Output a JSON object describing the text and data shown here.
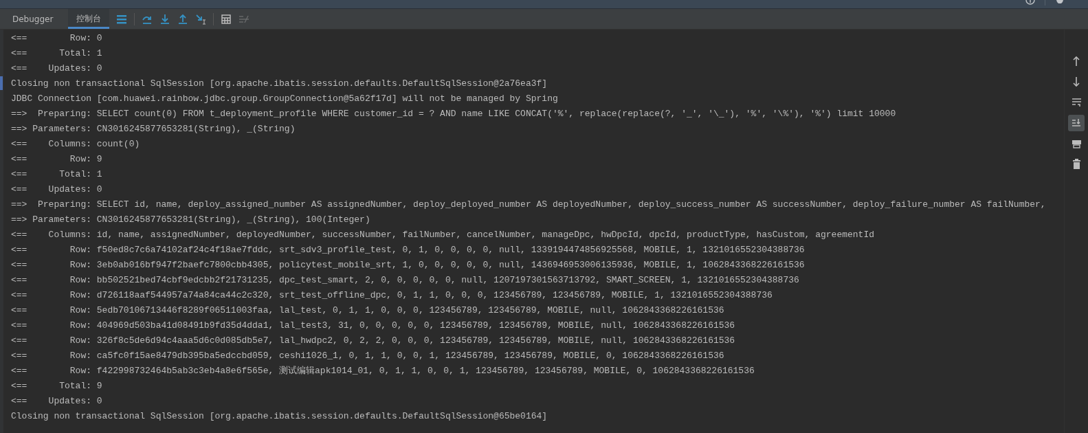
{
  "tabs": [
    {
      "label": "Debugger",
      "selected": false
    },
    {
      "label": "控制台",
      "selected": true
    }
  ],
  "toolbar": [
    {
      "kind": "menu",
      "disabled": false
    },
    {
      "kind": "step-over",
      "disabled": false
    },
    {
      "kind": "step-into",
      "disabled": false
    },
    {
      "kind": "step-out",
      "disabled": false
    },
    {
      "kind": "run-to-cursor",
      "disabled": false
    },
    {
      "kind": "evaluate",
      "disabled": false
    },
    {
      "kind": "trace",
      "disabled": true
    }
  ],
  "console": {
    "lines": [
      {
        "text": "<==        Row: 0",
        "marker": false
      },
      {
        "text": "<==      Total: 1",
        "marker": false
      },
      {
        "text": "<==    Updates: 0",
        "marker": false
      },
      {
        "text": "Closing non transactional SqlSession [org.apache.ibatis.session.defaults.DefaultSqlSession@2a76ea3f]",
        "marker": true
      },
      {
        "text": "JDBC Connection [com.huawei.rainbow.jdbc.group.GroupConnection@5a62f17d] will not be managed by Spring",
        "marker": false
      },
      {
        "text": "==>  Preparing: SELECT count(0) FROM t_deployment_profile WHERE customer_id = ? AND name LIKE CONCAT('%', replace(replace(?, '_', '\\_'), '%', '\\%'), '%') limit 10000",
        "marker": false
      },
      {
        "text": "==> Parameters: CN3016245877653281(String), _(String)",
        "marker": false
      },
      {
        "text": "<==    Columns: count(0)",
        "marker": false
      },
      {
        "text": "<==        Row: 9",
        "marker": false
      },
      {
        "text": "<==      Total: 1",
        "marker": false
      },
      {
        "text": "<==    Updates: 0",
        "marker": false
      },
      {
        "text": "==>  Preparing: SELECT id, name, deploy_assigned_number AS assignedNumber, deploy_deployed_number AS deployedNumber, deploy_success_number AS successNumber, deploy_failure_number AS failNumber,",
        "marker": false
      },
      {
        "text": "==> Parameters: CN3016245877653281(String), _(String), 100(Integer)",
        "marker": false
      },
      {
        "text": "<==    Columns: id, name, assignedNumber, deployedNumber, successNumber, failNumber, cancelNumber, manageDpc, hwDpcId, dpcId, productType, hasCustom, agreementId",
        "marker": false
      },
      {
        "text": "<==        Row: f50ed8c7c6a74102af24c4f18ae7fddc, srt_sdv3_profile_test, 0, 1, 0, 0, 0, 0, null, 1339194474856925568, MOBILE, 1, 1321016552304388736",
        "marker": false
      },
      {
        "text": "<==        Row: 3eb0ab016bf947f2baefc7800cbb4305, policytest_mobile_srt, 1, 0, 0, 0, 0, 0, null, 1436946953006135936, MOBILE, 1, 1062843368226161536",
        "marker": false
      },
      {
        "text": "<==        Row: bb502521bed74cbf9edcbb2f21731235, dpc_test_smart, 2, 0, 0, 0, 0, 0, null, 1207197301563713792, SMART_SCREEN, 1, 1321016552304388736",
        "marker": false
      },
      {
        "text": "<==        Row: d726118aaf544957a74a84ca44c2c320, srt_test_offline_dpc, 0, 1, 1, 0, 0, 0, 123456789, 123456789, MOBILE, 1, 1321016552304388736",
        "marker": false
      },
      {
        "text": "<==        Row: 5edb70106713446f8289f06511003faa, lal_test, 0, 1, 1, 0, 0, 0, 123456789, 123456789, MOBILE, null, 1062843368226161536",
        "marker": false
      },
      {
        "text": "<==        Row: 404969d503ba41d08491b9fd35d4dda1, lal_test3, 31, 0, 0, 0, 0, 0, 123456789, 123456789, MOBILE, null, 1062843368226161536",
        "marker": false
      },
      {
        "text": "<==        Row: 326f8c5de6d94c4aaa5d6c0d085db5e7, lal_hwdpc2, 0, 2, 2, 0, 0, 0, 123456789, 123456789, MOBILE, null, 1062843368226161536",
        "marker": false
      },
      {
        "text": "<==        Row: ca5fc0f15ae8479db395ba5edccbd059, ceshi1026_1, 0, 1, 1, 0, 0, 1, 123456789, 123456789, MOBILE, 0, 1062843368226161536",
        "marker": false
      },
      {
        "text": "<==        Row: f422998732464b5ab3c3eb4a8e6f565e, 测试编辑apk1014_01, 0, 1, 1, 0, 0, 1, 123456789, 123456789, MOBILE, 0, 1062843368226161536",
        "marker": false
      },
      {
        "text": "<==      Total: 9",
        "marker": false
      },
      {
        "text": "<==    Updates: 0",
        "marker": false
      },
      {
        "text": "Closing non transactional SqlSession [org.apache.ibatis.session.defaults.DefaultSqlSession@65be0164]",
        "marker": false
      }
    ]
  },
  "gutter": [
    {
      "kind": "up",
      "selected": false
    },
    {
      "kind": "down",
      "selected": false
    },
    {
      "kind": "soft-wrap",
      "selected": false
    },
    {
      "kind": "scroll-end",
      "selected": true
    },
    {
      "kind": "print",
      "selected": false
    },
    {
      "kind": "clear",
      "selected": false
    }
  ]
}
